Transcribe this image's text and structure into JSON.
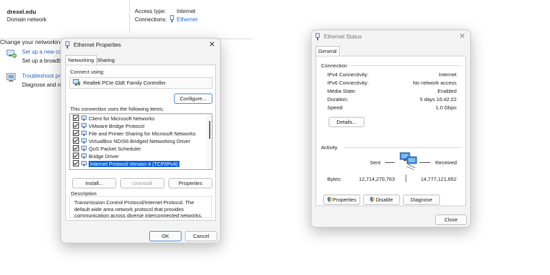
{
  "background": {
    "network_name": "drexel.edu",
    "network_type": "Domain network",
    "access_type_label": "Access type:",
    "access_type_value": "Internet",
    "connections_label": "Connections:",
    "connections_value": "Ethernet",
    "change_heading": "Change your networking se",
    "setup_link": "Set up a new con",
    "setup_desc": "Set up a broadba",
    "troubleshoot_link": "Troubleshoot pro",
    "troubleshoot_desc": "Diagnose and rep"
  },
  "ethernet_properties": {
    "title": "Ethernet Properties",
    "tabs": [
      "Networking",
      "Sharing"
    ],
    "connect_using_label": "Connect using:",
    "adapter_name": "Realtek PCIe GbE Family Controller",
    "configure_button": "Configure...",
    "items_label": "This connection uses the following items:",
    "items": [
      "Client for Microsoft Networks",
      "VMware Bridge Protocol",
      "File and Printer Sharing for Microsoft Networks",
      "VirtualBox NDIS6 Bridged Networking Driver",
      "QoS Packet Scheduler",
      "Bridge Driver",
      "Internet Protocol Version 4 (TCP/IPv4)"
    ],
    "install_button": "Install...",
    "uninstall_button": "Uninstall",
    "properties_button": "Properties",
    "description_label": "Description",
    "description_text": "Transmission Control Protocol/Internet Protocol. The default wide area network protocol that provides communication across diverse interconnected networks.",
    "ok_button": "OK",
    "cancel_button": "Cancel"
  },
  "ethernet_status": {
    "title": "Ethernet Status",
    "tab": "General",
    "connection_heading": "Connection",
    "rows": [
      {
        "label": "IPv4 Connectivity:",
        "value": "Internet"
      },
      {
        "label": "IPv6 Connectivity:",
        "value": "No network access"
      },
      {
        "label": "Media State:",
        "value": "Enabled"
      },
      {
        "label": "Duration:",
        "value": "5 days 16:42:22"
      },
      {
        "label": "Speed:",
        "value": "1.0 Gbps"
      }
    ],
    "details_button": "Details...",
    "activity_heading": "Activity",
    "sent_label": "Sent",
    "received_label": "Received",
    "bytes_label": "Bytes:",
    "bytes_sent": "12,714,270,763",
    "bytes_received": "14,777,121,652",
    "properties_button": "Properties",
    "disable_button": "Disable",
    "diagnose_button": "Diagnose",
    "close_button": "Close"
  }
}
